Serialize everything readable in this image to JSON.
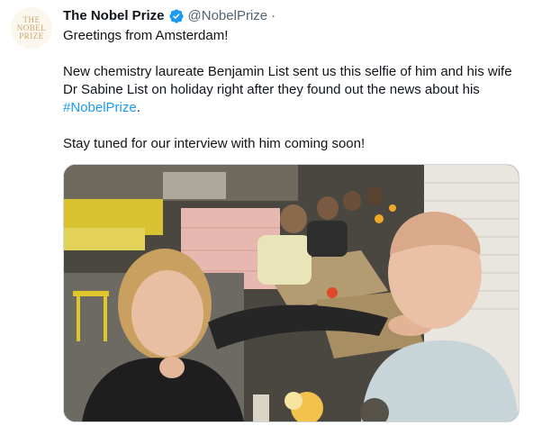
{
  "author": {
    "avatar_lines": [
      "THE",
      "NOBEL",
      "PRIZE"
    ],
    "name": "The Nobel Prize",
    "handle": "@NobelPrize",
    "separator": "·"
  },
  "tweet": {
    "greeting": "Greetings from Amsterdam!",
    "paragraph_main": "New chemistry laureate Benjamin List sent us this selfie of him and his wife Dr Sabine List on holiday right after they found out the news about his ",
    "hashtag": "#NobelPrize",
    "period": ".",
    "paragraph_end": "Stay tuned for our interview with him coming soon!"
  },
  "media": {
    "description": "selfie photo"
  },
  "colors": {
    "accent": "#1d9bf0",
    "avatar_gold": "#c9a66b",
    "verified_blue": "#1d9bf0"
  }
}
